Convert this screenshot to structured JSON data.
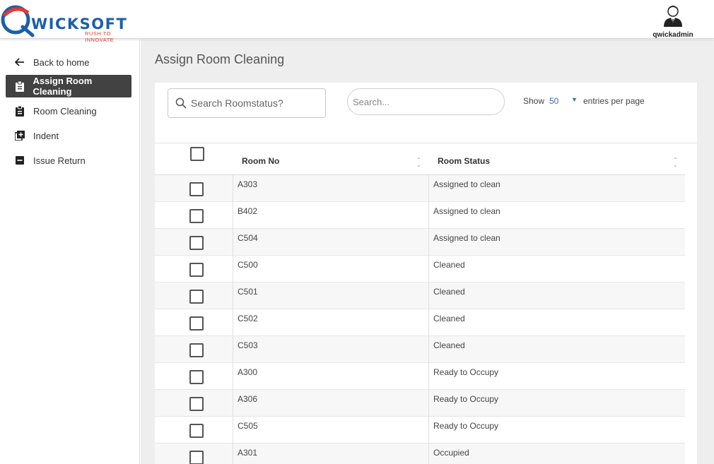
{
  "brand": {
    "logo_letter": "Q",
    "logo_text": "WICKSOFT",
    "tagline": "RUSH TO INNOVATE",
    "color_primary": "#1c5fa8",
    "color_accent": "#e53935"
  },
  "user": {
    "name": "qwickadmin",
    "icon": "user-avatar-icon"
  },
  "sidebar": {
    "items": [
      {
        "label": "Back to home",
        "icon": "arrow-left-icon",
        "active": false
      },
      {
        "label": "Assign Room Cleaning",
        "icon": "clipboard-icon",
        "active": true
      },
      {
        "label": "Room Cleaning",
        "icon": "clipboard-icon",
        "active": false
      },
      {
        "label": "Indent",
        "icon": "library-add-icon",
        "active": false
      },
      {
        "label": "Issue Return",
        "icon": "minus-box-icon",
        "active": false
      }
    ]
  },
  "page": {
    "title": "Assign Room Cleaning"
  },
  "controls": {
    "search_placeholder": "Search Roomstatus?",
    "filter_placeholder": "Search...",
    "show_label": "Show",
    "entries_value": "50",
    "entries_suffix": "entries per page"
  },
  "table": {
    "columns": [
      "Room No",
      "Room Status"
    ],
    "rows": [
      {
        "room": "A303",
        "status": "Assigned to clean"
      },
      {
        "room": "B402",
        "status": "Assigned to clean"
      },
      {
        "room": "C504",
        "status": "Assigned to clean"
      },
      {
        "room": "C500",
        "status": "Cleaned"
      },
      {
        "room": "C501",
        "status": "Cleaned"
      },
      {
        "room": "C502",
        "status": "Cleaned"
      },
      {
        "room": "C503",
        "status": "Cleaned"
      },
      {
        "room": "A300",
        "status": "Ready to Occupy"
      },
      {
        "room": "A306",
        "status": "Ready to Occupy"
      },
      {
        "room": "C505",
        "status": "Ready to Occupy"
      },
      {
        "room": "A301",
        "status": "Occupied"
      }
    ]
  }
}
